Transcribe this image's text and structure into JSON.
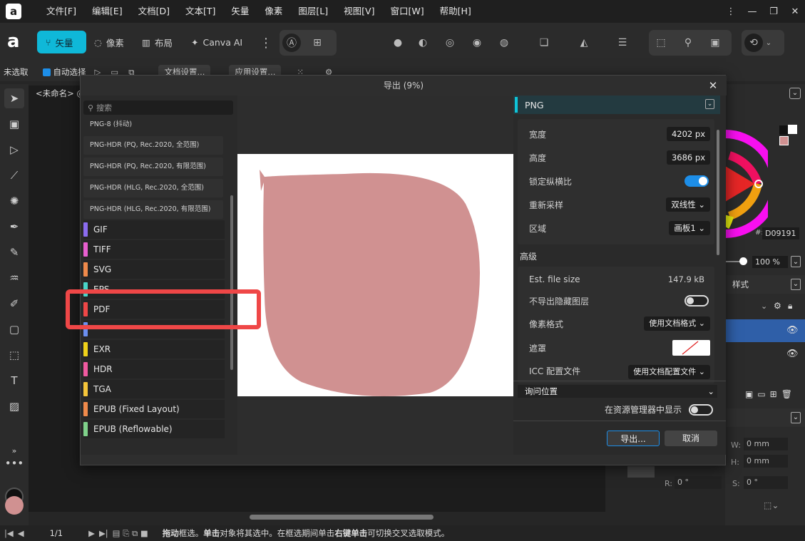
{
  "menu": {
    "items": [
      "文件[F]",
      "编辑[E]",
      "文档[D]",
      "文本[T]",
      "矢量",
      "像素",
      "图层[L]",
      "视图[V]",
      "窗口[W]",
      "帮助[H]"
    ],
    "logo": "a"
  },
  "window_controls": [
    "⋮",
    "—",
    "❐",
    "✕"
  ],
  "toolbar": {
    "persona_vector": "矢量",
    "persona_pixel": "像素",
    "persona_layout": "布局",
    "persona_canva": "Canva AI"
  },
  "context": {
    "no_selection": "未选取",
    "auto_select": "自动选择",
    "doc_settings": "文档设置...",
    "app_settings": "应用设置..."
  },
  "document_tab": "<未命名> @",
  "dialog": {
    "title": "导出 (9%)",
    "search_placeholder": "搜索",
    "sub_items": [
      "PNG-8 (抖动)",
      "PNG-HDR (PQ, Rec.2020, 全范围)",
      "PNG-HDR (PQ, Rec.2020, 有限范围)",
      "PNG-HDR (HLG, Rec.2020, 全范围)",
      "PNG-HDR (HLG, Rec.2020, 有限范围)"
    ],
    "formats": [
      {
        "label": "GIF",
        "color": "#8b6cf0"
      },
      {
        "label": "TIFF",
        "color": "#e85fd0"
      },
      {
        "label": "SVG",
        "color": "#f08a4b"
      },
      {
        "label": "EPS",
        "color": "#49d4c8"
      },
      {
        "label": "PDF",
        "color": "#ef4747"
      },
      {
        "label": "",
        "color": "#6b8ff0"
      },
      {
        "label": "EXR",
        "color": "#f0d21a"
      },
      {
        "label": "HDR",
        "color": "#f05aa0"
      },
      {
        "label": "TGA",
        "color": "#f5c53a"
      },
      {
        "label": "EPUB (Fixed Layout)",
        "color": "#f08a4b"
      },
      {
        "label": "EPUB (Reflowable)",
        "color": "#7fd18a"
      }
    ],
    "preview_shape_color": "#d09191",
    "settings": {
      "format": "PNG",
      "width_label": "宽度",
      "width_value": "4202 px",
      "height_label": "高度",
      "height_value": "3686 px",
      "lock_aspect_label": "锁定纵横比",
      "lock_aspect_on": true,
      "resample_label": "重新采样",
      "resample_value": "双线性",
      "area_label": "区域",
      "area_value": "画板1",
      "advanced_label": "高级",
      "filesize_label": "Est. file size",
      "filesize_value": "147.9 kB",
      "no_hidden_label": "不导出隐藏图层",
      "no_hidden_on": false,
      "pixel_format_label": "像素格式",
      "pixel_format_value": "使用文档格式",
      "matte_label": "遮罩",
      "icc_label": "ICC 配置文件",
      "icc_value": "使用文档配置文件"
    },
    "location_value": "询问位置",
    "show_in_explorer_label": "在资源管理器中显示",
    "export_button": "导出...",
    "cancel_button": "取消"
  },
  "right_panel": {
    "hex_prefix": "#:",
    "hex_value": "D09191",
    "opacity": "100 %",
    "styles_tab": "样式",
    "w_label": "W:",
    "w_value": "0 mm",
    "h_label": "H:",
    "h_value": "0 mm",
    "r_label": "R:",
    "r_value": "0 °",
    "s_label": "S:",
    "s_value": "0 °"
  },
  "status": {
    "page": "1/1",
    "hint_drag": "拖动",
    "hint_text1": " 框选。",
    "hint_click": "单击",
    "hint_text2": " 对象将其选中。在框选期间单击 ",
    "hint_right": "右键单击",
    "hint_text3": " 可切换交叉选取模式。"
  }
}
